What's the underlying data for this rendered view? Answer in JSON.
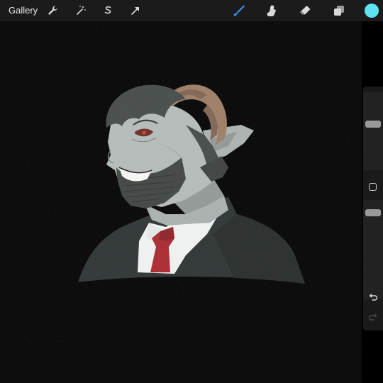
{
  "toolbar": {
    "gallery_label": "Gallery",
    "actions_icon": "wrench-icon",
    "adjustments_icon": "magic-wand-icon",
    "selection_icon": "selection-s-icon",
    "transform_icon": "arrow-cursor-icon",
    "brush_icon": "brush-icon",
    "smudge_icon": "smudge-finger-icon",
    "eraser_icon": "eraser-icon",
    "layers_icon": "layers-icon",
    "active_color": "#5ee3f0",
    "brush_active_color": "#3d8ff0"
  },
  "sidebar": {
    "brush_size_level": 0.6,
    "opacity_level": 0.9,
    "undo_icon": "undo-icon",
    "redo_icon": "redo-icon"
  },
  "canvas": {
    "background": "#000000",
    "artwork": "bearded-man-with-horns-portrait"
  }
}
